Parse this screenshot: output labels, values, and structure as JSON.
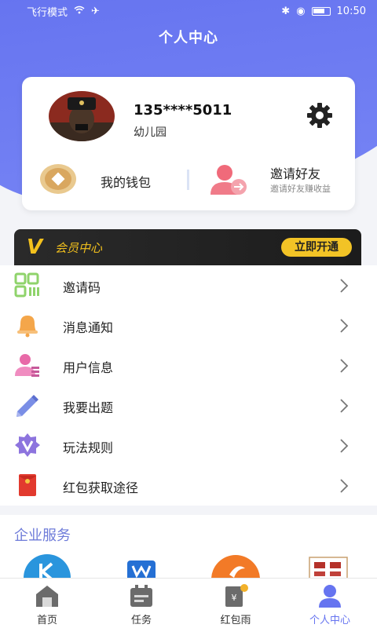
{
  "status_bar": {
    "mode": "飞行模式",
    "time": "10:50"
  },
  "header": {
    "title": "个人中心"
  },
  "profile": {
    "phone": "135****5011",
    "subtitle": "幼儿园",
    "wallet_label": "我的钱包",
    "invite_label": "邀请好友",
    "invite_sub": "邀请好友赚收益"
  },
  "vip": {
    "badge": "V",
    "label": "会员中心",
    "button": "立即开通"
  },
  "menu": [
    {
      "label": "邀请码",
      "icon": "qr-code-icon"
    },
    {
      "label": "消息通知",
      "icon": "bell-icon"
    },
    {
      "label": "用户信息",
      "icon": "user-info-icon"
    },
    {
      "label": "我要出题",
      "icon": "pencil-icon"
    },
    {
      "label": "玩法规则",
      "icon": "rules-badge-icon"
    },
    {
      "label": "红包获取途径",
      "icon": "red-envelope-icon"
    }
  ],
  "enterprise": {
    "title": "企业服务"
  },
  "tabbar": {
    "items": [
      {
        "label": "首页",
        "icon": "home-icon"
      },
      {
        "label": "任务",
        "icon": "task-calendar-icon"
      },
      {
        "label": "红包雨",
        "icon": "red-packet-rain-icon"
      },
      {
        "label": "个人中心",
        "icon": "profile-icon"
      }
    ],
    "active_index": 3
  },
  "colors": {
    "accent": "#6674f0",
    "vip_gold": "#f3c11d",
    "vip_bg": "#1f1f1f"
  }
}
